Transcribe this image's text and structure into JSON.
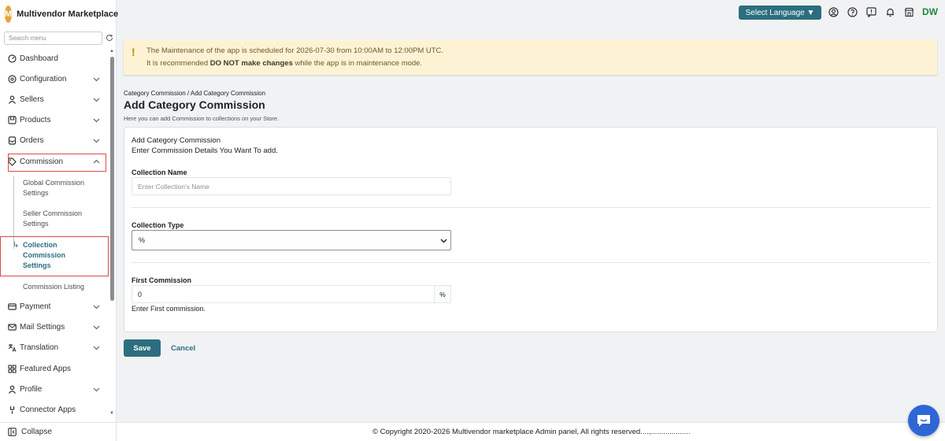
{
  "brand": {
    "initial": "M",
    "name": "Multivendor Marketplace",
    "color": "#e8a43c"
  },
  "sidebar": {
    "search_placeholder": "Search menu",
    "items": [
      {
        "label": "Dashboard",
        "icon": "dashboard-icon",
        "expandable": false
      },
      {
        "label": "Configuration",
        "icon": "gear-icon",
        "expandable": true
      },
      {
        "label": "Sellers",
        "icon": "person-icon",
        "expandable": true
      },
      {
        "label": "Products",
        "icon": "product-icon",
        "expandable": true
      },
      {
        "label": "Orders",
        "icon": "orders-icon",
        "expandable": true
      },
      {
        "label": "Commission",
        "icon": "commission-icon",
        "expandable": true,
        "expanded": true
      },
      {
        "label": "Payment",
        "icon": "payment-icon",
        "expandable": true
      },
      {
        "label": "Mail Settings",
        "icon": "mail-icon",
        "expandable": true
      },
      {
        "label": "Translation",
        "icon": "translate-icon",
        "expandable": true
      },
      {
        "label": "Featured Apps",
        "icon": "apps-icon",
        "expandable": false
      },
      {
        "label": "Profile",
        "icon": "person-icon",
        "expandable": true
      },
      {
        "label": "Connector Apps",
        "icon": "plug-icon",
        "expandable": false
      }
    ],
    "commission_sub": [
      {
        "label": "Global Commission Settings",
        "active": false
      },
      {
        "label": "Seller Commission Settings",
        "active": false
      },
      {
        "label": "Collection Commission Settings",
        "active": true
      },
      {
        "label": "Commission Listing",
        "active": false
      }
    ],
    "collapse_label": "Collapse"
  },
  "topbar": {
    "language_button": "Select Language ▼",
    "user_initials": "DW",
    "icons": [
      "user-circle-icon",
      "help-icon",
      "feedback-icon",
      "bell-icon",
      "store-icon"
    ]
  },
  "banner": {
    "line1": "The Maintenance of the app is scheduled for 2026-07-30 from 10:00AM to 12:00PM UTC.",
    "line2_prefix": "It is recommended ",
    "line2_bold": "DO NOT make changes",
    "line2_suffix": " while the app is in maintenance mode."
  },
  "page": {
    "breadcrumb": "Category Commission / Add Category Commission",
    "title": "Add Category Commission",
    "subtitle": "Here you can add Commission to collections on your Store."
  },
  "form": {
    "card_title": "Add Category Commission",
    "card_desc": "Enter Commission Details You Want To add.",
    "collection_name_label": "Collection Name",
    "collection_name_placeholder": "Enter Collection's Name",
    "collection_type_label": "Collection Type",
    "collection_type_value": "%",
    "first_commission_label": "First Commission",
    "first_commission_value": "0",
    "first_commission_suffix": "%",
    "first_commission_help": "Enter First commission."
  },
  "actions": {
    "save": "Save",
    "cancel": "Cancel"
  },
  "footer": {
    "text": "© Copyright 2020-2026 Multivendor marketplace Admin panel, All rights reserved....,..................."
  },
  "colors": {
    "primary": "#2c6e7f",
    "highlight": "#e04848",
    "banner_bg": "#fdf3d4",
    "chat": "#2e66d6"
  }
}
